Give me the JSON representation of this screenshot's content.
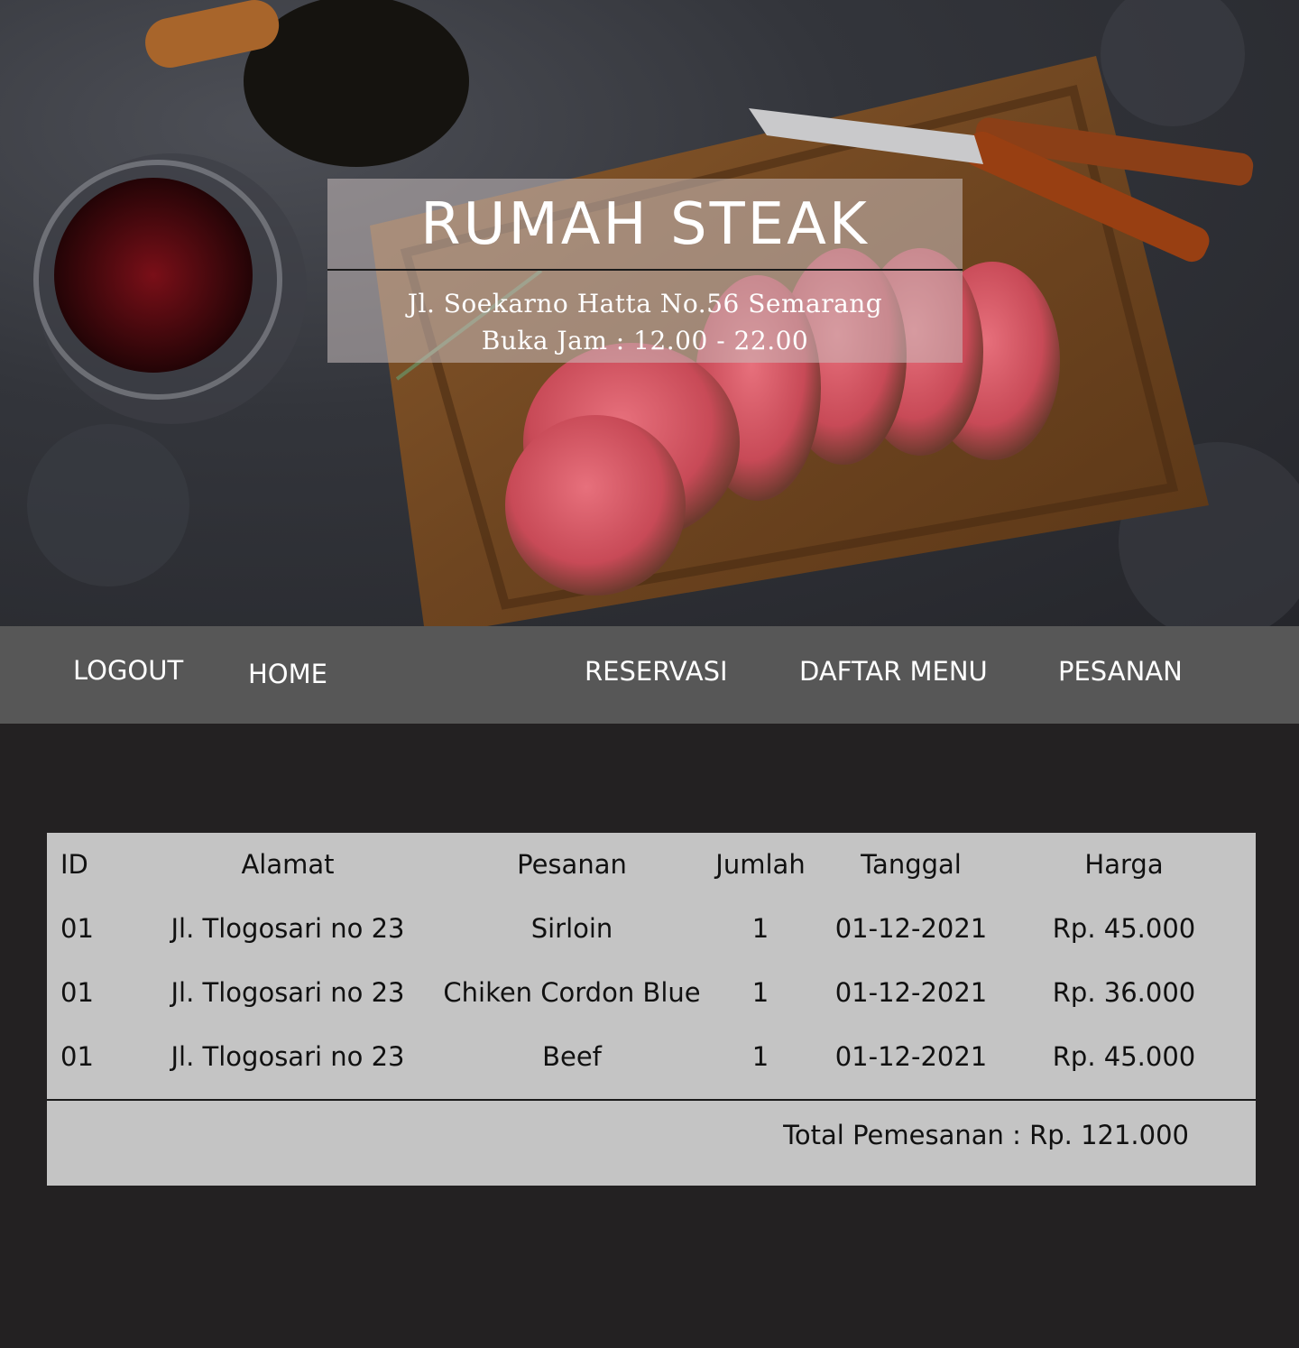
{
  "hero": {
    "title": "RUMAH STEAK",
    "address": "Jl. Soekarno Hatta No.56 Semarang",
    "hours": "Buka Jam : 12.00 - 22.00"
  },
  "nav": {
    "logout": "LOGOUT",
    "home": "HOME",
    "reservasi": "RESERVASI",
    "daftar_menu": "DAFTAR MENU",
    "pesanan": "PESANAN"
  },
  "orders": {
    "headers": {
      "id": "ID",
      "alamat": "Alamat",
      "pesanan": "Pesanan",
      "jumlah": "Jumlah",
      "tanggal": "Tanggal",
      "harga": "Harga"
    },
    "rows": [
      {
        "id": "01",
        "alamat": "Jl. Tlogosari no 23",
        "pesanan": "Sirloin",
        "jumlah": "1",
        "tanggal": "01-12-2021",
        "harga": "Rp. 45.000"
      },
      {
        "id": "01",
        "alamat": "Jl. Tlogosari no 23",
        "pesanan": "Chiken Cordon Blue",
        "jumlah": "1",
        "tanggal": "01-12-2021",
        "harga": "Rp. 36.000"
      },
      {
        "id": "01",
        "alamat": "Jl. Tlogosari no 23",
        "pesanan": "Beef",
        "jumlah": "1",
        "tanggal": "01-12-2021",
        "harga": "Rp. 45.000"
      }
    ],
    "total": "Total Pemesanan : Rp. 121.000"
  },
  "colors": {
    "page_background": "#232122",
    "nav_background": "#575757",
    "table_background": "#c4c4c4",
    "brand_box": "rgba(200,190,190,0.55)"
  }
}
